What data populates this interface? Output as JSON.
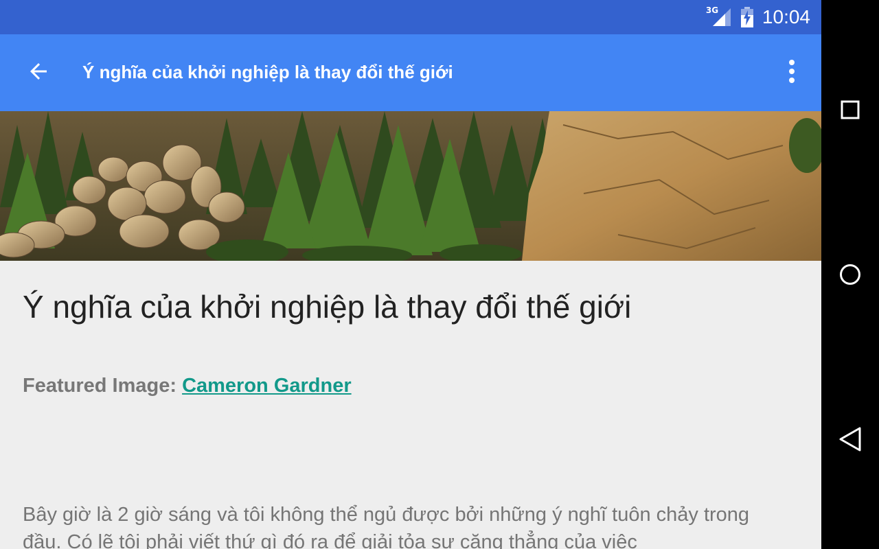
{
  "status_bar": {
    "network": "3G",
    "time": "10:04"
  },
  "app_bar": {
    "title": "Ý nghĩa của khởi nghiệp là thay đổi thế giới",
    "back_icon": "arrow-back-icon",
    "menu_icon": "more-vert-icon"
  },
  "article": {
    "title": "Ý nghĩa của khởi nghiệp là thay đổi thế giới",
    "featured_label": "Featured Image:",
    "featured_author": "Cameron Gardner",
    "body_text": "Bây giờ là 2 giờ sáng và tôi không thể ngủ được bởi những ý nghĩ tuôn chảy trong đầu. Có lẽ tôi phải viết thứ gì đó ra để giải tỏa sự căng thẳng của việc"
  },
  "navigation": {
    "recents_icon": "square-recents-icon",
    "home_icon": "circle-home-icon",
    "back_icon": "triangle-back-icon"
  },
  "colors": {
    "status_bar": "#3462cf",
    "app_bar": "#4285f4",
    "link": "#12998a",
    "background": "#eeeeee"
  }
}
